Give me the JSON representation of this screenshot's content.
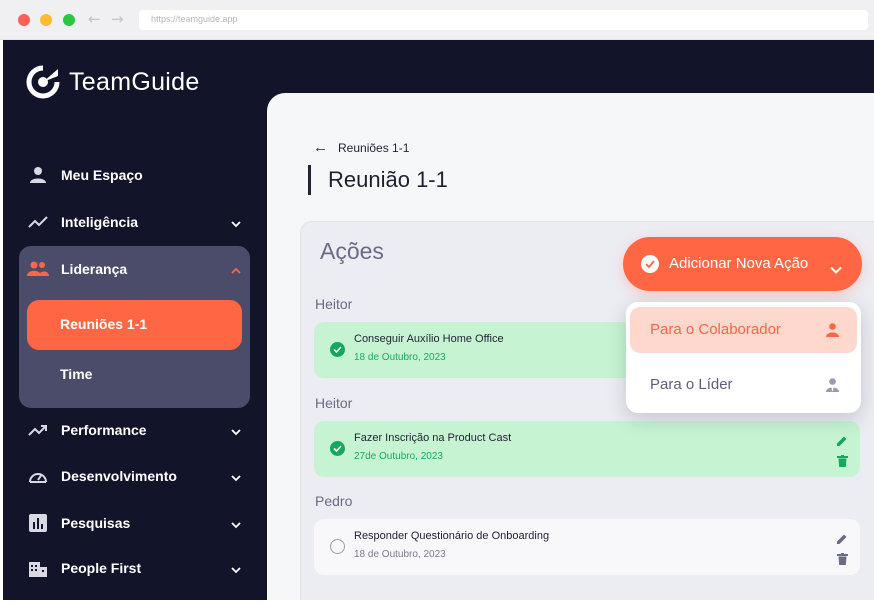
{
  "browser": {
    "url": "https://teamguide.app"
  },
  "brand": {
    "name": "TeamGuide",
    "colors": {
      "accent": "#ff6643",
      "sidebar": "#12142a",
      "success": "#14a85e"
    }
  },
  "sidebar": {
    "items": [
      {
        "label": "Meu Espaço",
        "icon": "user-icon"
      },
      {
        "label": "Inteligência",
        "icon": "trend-icon"
      },
      {
        "label": "Liderança",
        "icon": "team-icon"
      },
      {
        "label": "Performance",
        "icon": "trend-up-icon"
      },
      {
        "label": "Desenvolvimento",
        "icon": "gauge-icon"
      },
      {
        "label": "Pesquisas",
        "icon": "bar-chart-icon"
      },
      {
        "label": "People First",
        "icon": "building-icon"
      }
    ],
    "sub_items": [
      {
        "label": "Reuniões 1-1",
        "active": true
      },
      {
        "label": "Time",
        "active": false
      }
    ]
  },
  "main": {
    "breadcrumb": "Reuniões 1-1",
    "title": "Reunião 1-1",
    "card_title": "Ações",
    "add_button_label": "Adicionar Nova Ação",
    "dropdown": [
      {
        "label": "Para o Colaborador",
        "icon": "person-icon"
      },
      {
        "label": "Para o Líder",
        "icon": "person-tie-icon"
      }
    ],
    "groups": [
      {
        "person": "Heitor",
        "task": "Conseguir Auxílio Home Office",
        "date": "18 de Outubro, 2023",
        "done": true
      },
      {
        "person": "Heitor",
        "task": "Fazer Inscrição na Product Cast",
        "date": "27de Outubro, 2023",
        "done": true
      },
      {
        "person": "Pedro",
        "task": "Responder Questionário de Onboarding",
        "date": "18 de Outubro, 2023",
        "done": false
      }
    ]
  }
}
